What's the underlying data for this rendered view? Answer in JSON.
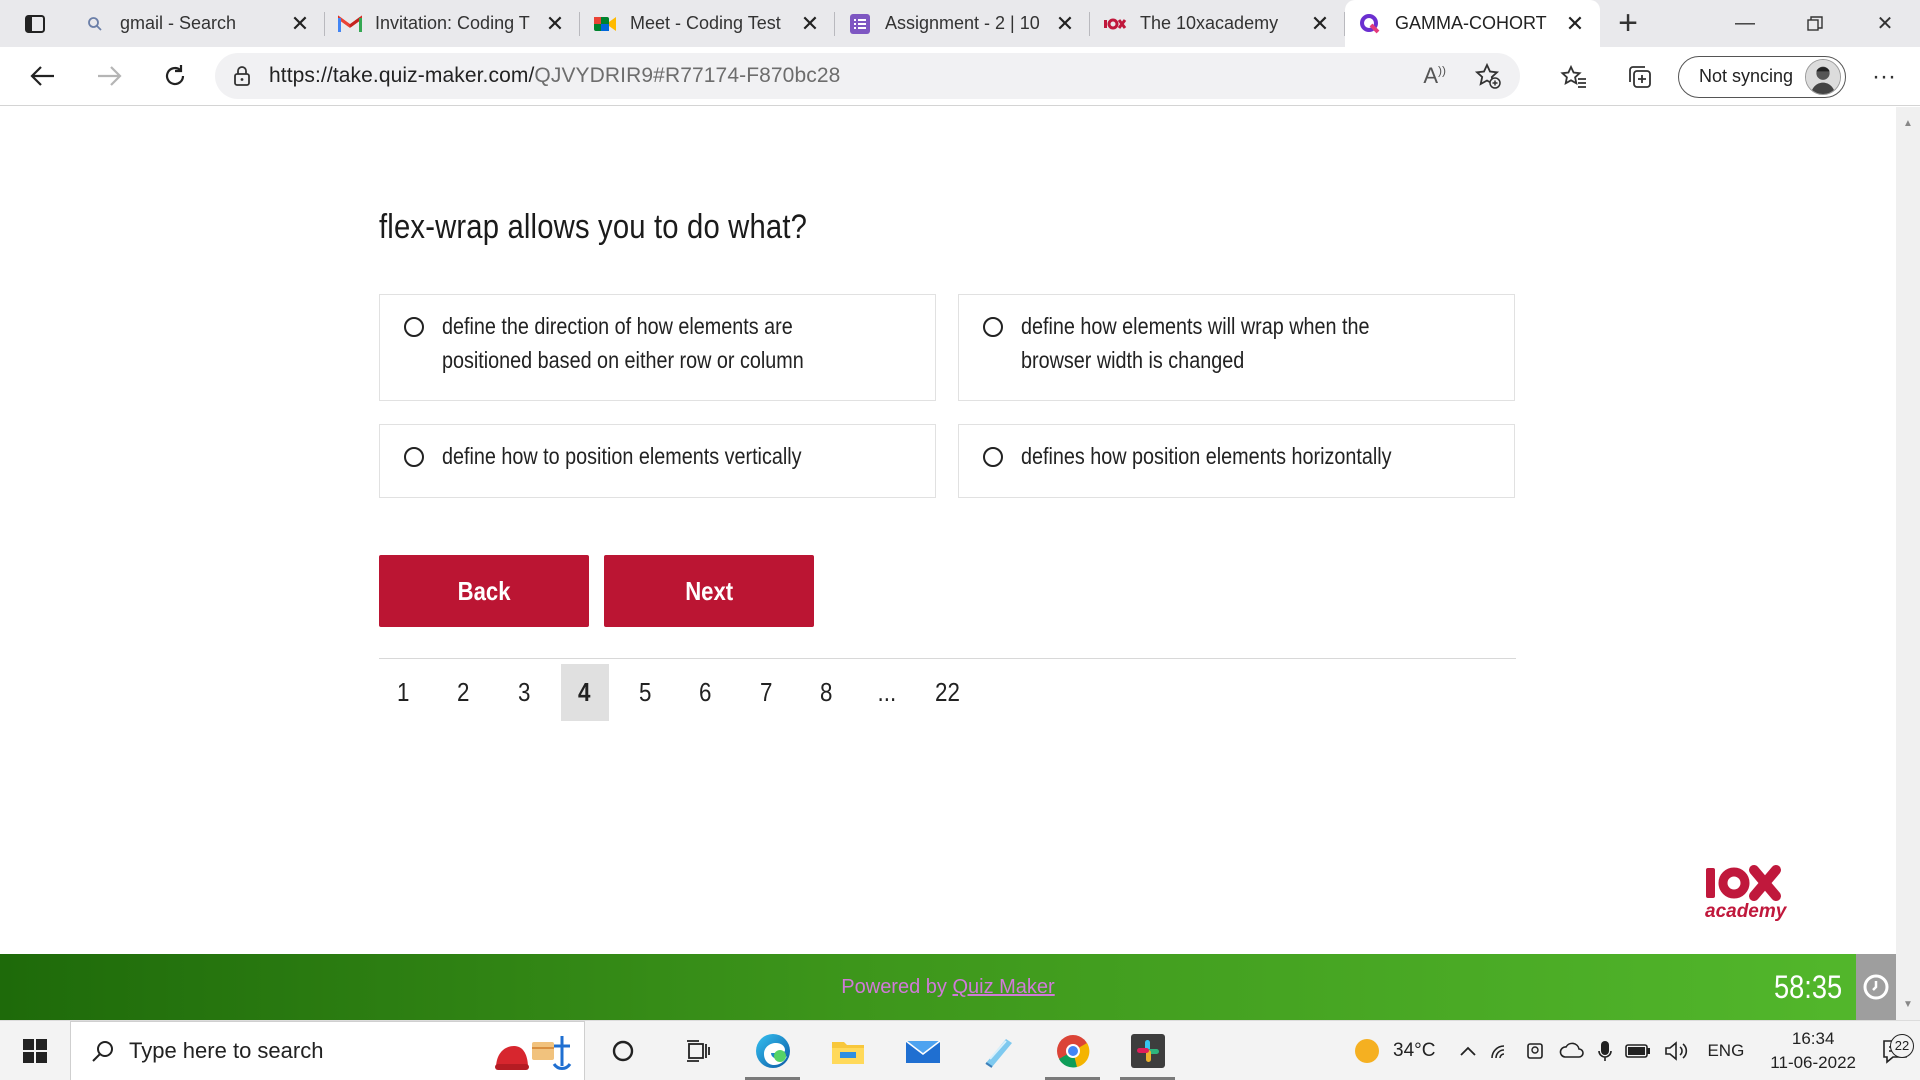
{
  "browser": {
    "tabs": [
      {
        "title": "gmail - Search",
        "icon": "search-favicon"
      },
      {
        "title": "Invitation: Coding T",
        "icon": "gmail-favicon"
      },
      {
        "title": "Meet - Coding Test",
        "icon": "meet-favicon"
      },
      {
        "title": "Assignment - 2 | 10",
        "icon": "forms-favicon"
      },
      {
        "title": "The 10xacademy",
        "icon": "10x-favicon"
      },
      {
        "title": "GAMMA-COHORT",
        "icon": "quiz-maker-favicon",
        "active": true
      }
    ],
    "url_host": "https://take.quiz-maker.com/",
    "url_rest": "QJVYDRIR9#R77174-F870bc28",
    "profile_label": "Not syncing"
  },
  "quiz": {
    "question": "flex-wrap allows you to do what?",
    "options": [
      "define the direction of how elements are positioned based on either row or column",
      "define how elements will wrap when the browser width is changed",
      "define how to position elements vertically",
      "defines how position elements horizontally"
    ],
    "back_label": "Back",
    "next_label": "Next",
    "pages": [
      "1",
      "2",
      "3",
      "4",
      "5",
      "6",
      "7",
      "8",
      "...",
      "22"
    ],
    "current_page": "4"
  },
  "footer": {
    "powered_prefix": "Powered by ",
    "powered_link": "Quiz Maker",
    "timer": "58:35"
  },
  "taskbar": {
    "search_placeholder": "Type here to search",
    "temperature": "34°C",
    "language": "ENG",
    "time": "16:34",
    "date": "11-06-2022",
    "notification_count": "22"
  },
  "colors": {
    "accent": "#bb1533",
    "footer_start": "#1e6a0a",
    "footer_end": "#53b82c",
    "powered_text": "#d07ad8"
  }
}
